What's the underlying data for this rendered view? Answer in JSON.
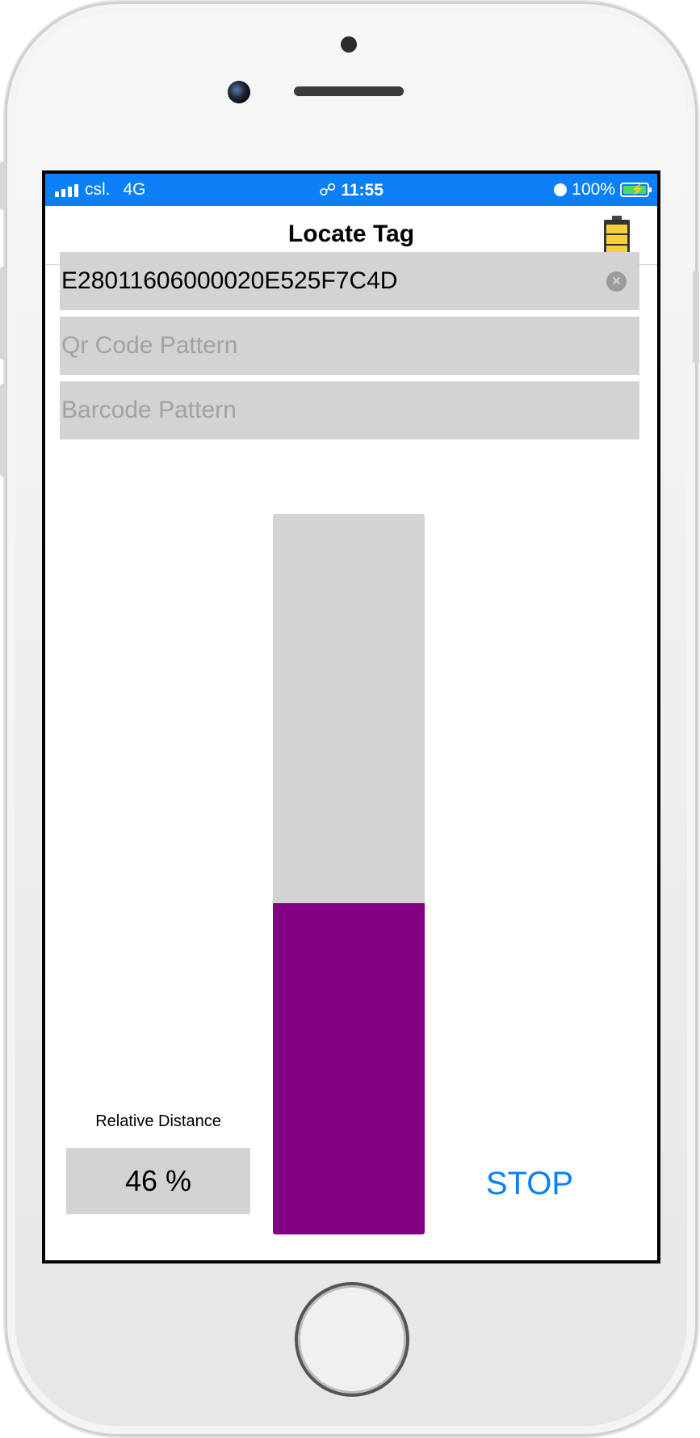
{
  "status_bar": {
    "carrier": "csl.",
    "network": "4G",
    "time": "11:55",
    "battery_percent": "100%",
    "icons": [
      "signal-icon",
      "link-icon",
      "alarm-icon",
      "battery-charging-icon"
    ]
  },
  "nav": {
    "title": "Locate Tag",
    "reader_battery_icon": "battery-level-icon",
    "reader_battery_level": 0.8
  },
  "fields": {
    "epc_value": "E28011606000020E525F7C4D",
    "qr_placeholder": "Qr Code Pattern",
    "barcode_placeholder": "Barcode Pattern"
  },
  "gauge": {
    "level": 0.46
  },
  "distance": {
    "label": "Relative Distance",
    "value": "46 %"
  },
  "actions": {
    "stop_label": "STOP"
  },
  "colors": {
    "status_bar": "#0a7ff6",
    "field_bg": "#d3d3d3",
    "gauge_fill": "#800080",
    "accent": "#0a7ff6"
  }
}
